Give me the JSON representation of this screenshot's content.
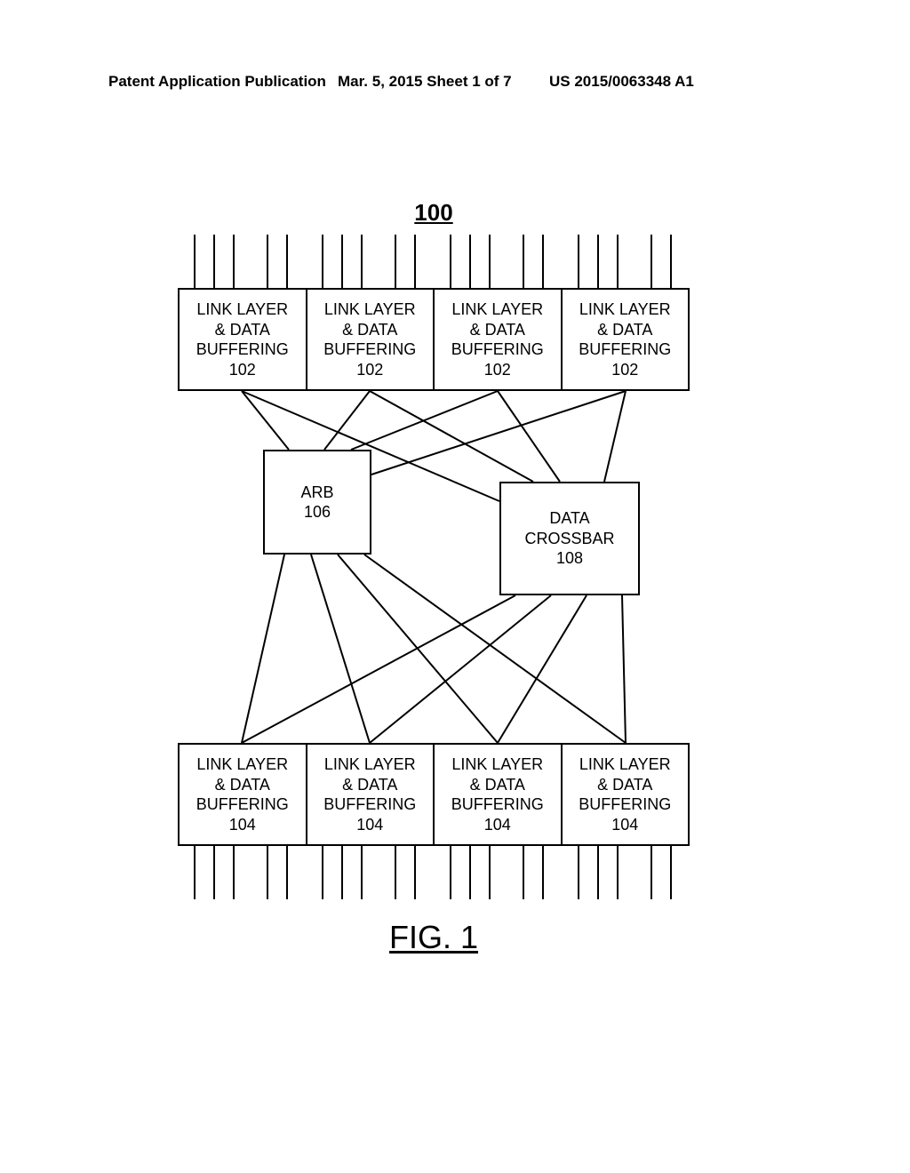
{
  "header": {
    "left": "Patent Application Publication",
    "mid": "Mar. 5, 2015  Sheet 1 of 7",
    "right": "US 2015/0063348 A1"
  },
  "figure": {
    "ref": "100",
    "caption": "FIG. 1",
    "top_blocks": [
      {
        "l1": "LINK LAYER",
        "l2": "& DATA",
        "l3": "BUFFERING",
        "num": "102"
      },
      {
        "l1": "LINK LAYER",
        "l2": "& DATA",
        "l3": "BUFFERING",
        "num": "102"
      },
      {
        "l1": "LINK LAYER",
        "l2": "& DATA",
        "l3": "BUFFERING",
        "num": "102"
      },
      {
        "l1": "LINK LAYER",
        "l2": "& DATA",
        "l3": "BUFFERING",
        "num": "102"
      }
    ],
    "bot_blocks": [
      {
        "l1": "LINK LAYER",
        "l2": "& DATA",
        "l3": "BUFFERING",
        "num": "104"
      },
      {
        "l1": "LINK LAYER",
        "l2": "& DATA",
        "l3": "BUFFERING",
        "num": "104"
      },
      {
        "l1": "LINK LAYER",
        "l2": "& DATA",
        "l3": "BUFFERING",
        "num": "104"
      },
      {
        "l1": "LINK LAYER",
        "l2": "& DATA",
        "l3": "BUFFERING",
        "num": "104"
      }
    ],
    "arb": {
      "label": "ARB",
      "num": "106"
    },
    "crossbar": {
      "l1": "DATA",
      "l2": "CROSSBAR",
      "num": "108"
    }
  }
}
